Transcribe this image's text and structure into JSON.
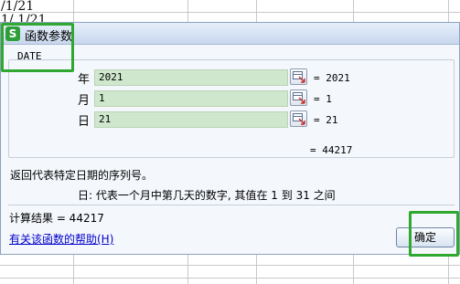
{
  "sheet": {
    "cell_text_1": "/1/21",
    "cell_text_2": "1/ 1/21"
  },
  "dialog": {
    "title": "函数参数",
    "app_icon": "S",
    "function_name": "DATE",
    "args": [
      {
        "label": "年",
        "value": "2021",
        "result": "= 2021"
      },
      {
        "label": "月",
        "value": "1",
        "result": "= 1"
      },
      {
        "label": "日",
        "value": "21",
        "result": "= 21"
      }
    ],
    "formula_result": "= 44217",
    "description": "返回代表特定日期的序列号。",
    "param_description": "日:  代表一个月中第几天的数字, 其值在 1 到 31 之间",
    "calc_result": "计算结果 = 44217",
    "help_link": "有关该函数的帮助(H)",
    "ok_label": "确定"
  },
  "colors": {
    "highlight": "#2fa82f",
    "input_bg": "#cfe8cd",
    "link": "#0000cc"
  },
  "icons": {
    "ref_button": "range-select-icon"
  }
}
